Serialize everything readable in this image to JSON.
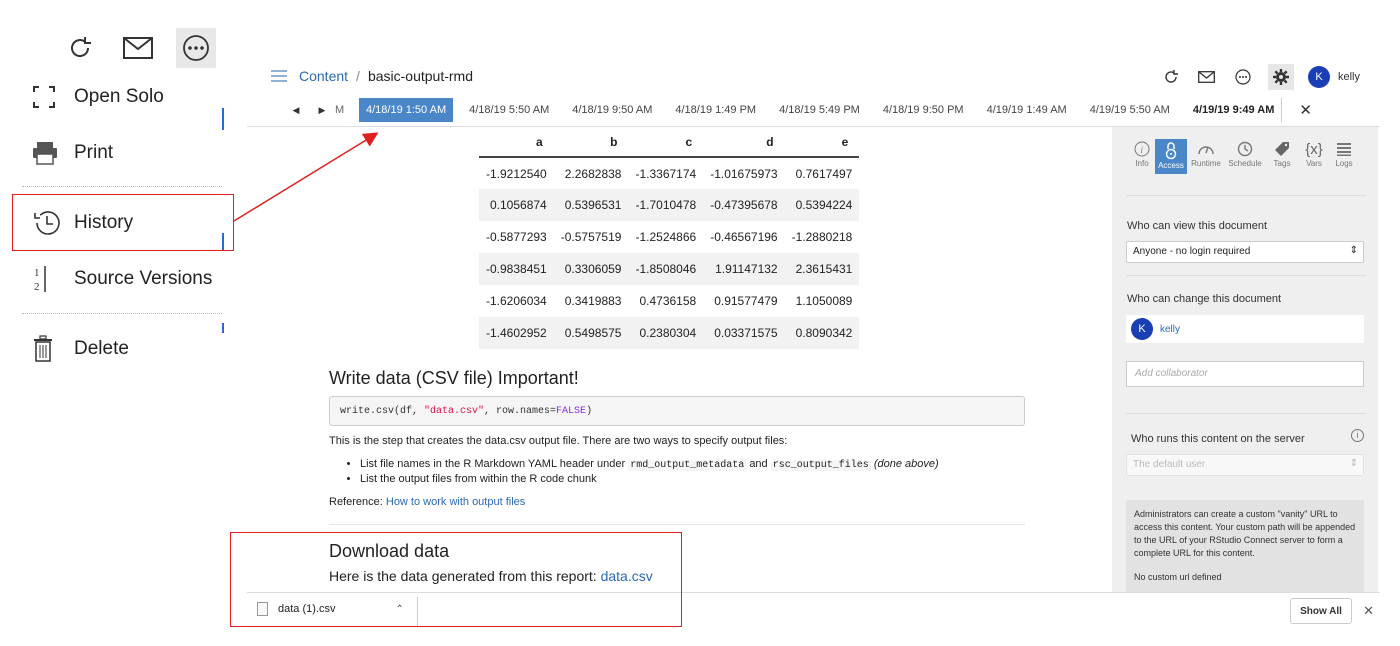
{
  "menu": {
    "toolbar_icons": [
      "refresh-icon",
      "mail-icon",
      "more-icon"
    ],
    "open_solo": "Open Solo",
    "print": "Print",
    "history": "History",
    "source_versions": "Source Versions",
    "delete": "Delete"
  },
  "breadcrumb": {
    "root": "Content",
    "separator": "/",
    "current": "basic-output-rmd"
  },
  "user": {
    "initial": "K",
    "name": "kelly"
  },
  "versions": {
    "partial_label": "M",
    "items": [
      "4/18/19 1:50 AM",
      "4/18/19 5:50 AM",
      "4/18/19 9:50 AM",
      "4/18/19 1:49 PM",
      "4/18/19 5:49 PM",
      "4/18/19 9:50 PM",
      "4/19/19 1:49 AM",
      "4/19/19 5:50 AM",
      "4/19/19 9:49 AM"
    ],
    "selected_index": 0
  },
  "table": {
    "headers": [
      "a",
      "b",
      "c",
      "d",
      "e"
    ],
    "rows": [
      [
        "-1.9212540",
        "2.2682838",
        "-1.3367174",
        "-1.01675973",
        "0.7617497"
      ],
      [
        "0.1056874",
        "0.5396531",
        "-1.7010478",
        "-0.47395678",
        "0.5394224"
      ],
      [
        "-0.5877293",
        "-0.5757519",
        "-1.2524866",
        "-0.46567196",
        "-1.2880218"
      ],
      [
        "-0.9838451",
        "0.3306059",
        "-1.8508046",
        "1.91147132",
        "2.3615431"
      ],
      [
        "-1.6206034",
        "0.3419883",
        "0.4736158",
        "0.91577479",
        "1.1050089"
      ],
      [
        "-1.4602952",
        "0.5498575",
        "0.2380304",
        "0.03371575",
        "0.8090342"
      ]
    ]
  },
  "doc": {
    "write_heading": "Write data (CSV file) Important!",
    "code_prefix": "write.csv(df, ",
    "code_string": "\"data.csv\"",
    "code_middle": ", row.names=",
    "code_keyword": "FALSE",
    "code_suffix": ")",
    "intro": "This is the step that creates the data.csv output file. There are two ways to specify output files:",
    "bullet1_pre": "List file names in the R Markdown YAML header under",
    "bullet1_code1": "rmd_output_metadata",
    "bullet1_and": "and",
    "bullet1_code2": "rsc_output_files",
    "bullet1_note": "(done above)",
    "bullet2": "List the output files from within the R code chunk",
    "reference_label": "Reference:",
    "reference_link": "How to work with output files",
    "download_heading": "Download data",
    "download_text": "Here is the data generated from this report:",
    "download_link": "data.csv"
  },
  "settings_panel": {
    "tabs": [
      {
        "label": "Info",
        "icon": "info-icon"
      },
      {
        "label": "Access",
        "icon": "lock-icon"
      },
      {
        "label": "Runtime",
        "icon": "gauge-icon"
      },
      {
        "label": "Schedule",
        "icon": "clock-icon"
      },
      {
        "label": "Tags",
        "icon": "tag-icon"
      },
      {
        "label": "Vars",
        "icon": "braces-icon"
      },
      {
        "label": "Logs",
        "icon": "logs-icon"
      }
    ],
    "active_tab": "Access",
    "view_label": "Who can view this document",
    "view_value": "Anyone - no login required",
    "change_label": "Who can change this document",
    "collaborator_name": "kelly",
    "add_collaborator_placeholder": "Add collaborator",
    "runs_label": "Who runs this content on the server",
    "runs_value": "The default user",
    "vanity_note": "Administrators can create a custom \"vanity\" URL to access this content. Your custom path will be appended to the URL of your RStudio Connect server to form a complete URL for this content.",
    "vanity_status": "No custom url defined"
  },
  "download_bar": {
    "file_name": "data (1).csv",
    "show_all": "Show All"
  },
  "colors": {
    "accent": "#4a87c9",
    "link": "#2a6ab3",
    "avatar": "#1a3fb5",
    "highlight_box": "#e02020"
  }
}
